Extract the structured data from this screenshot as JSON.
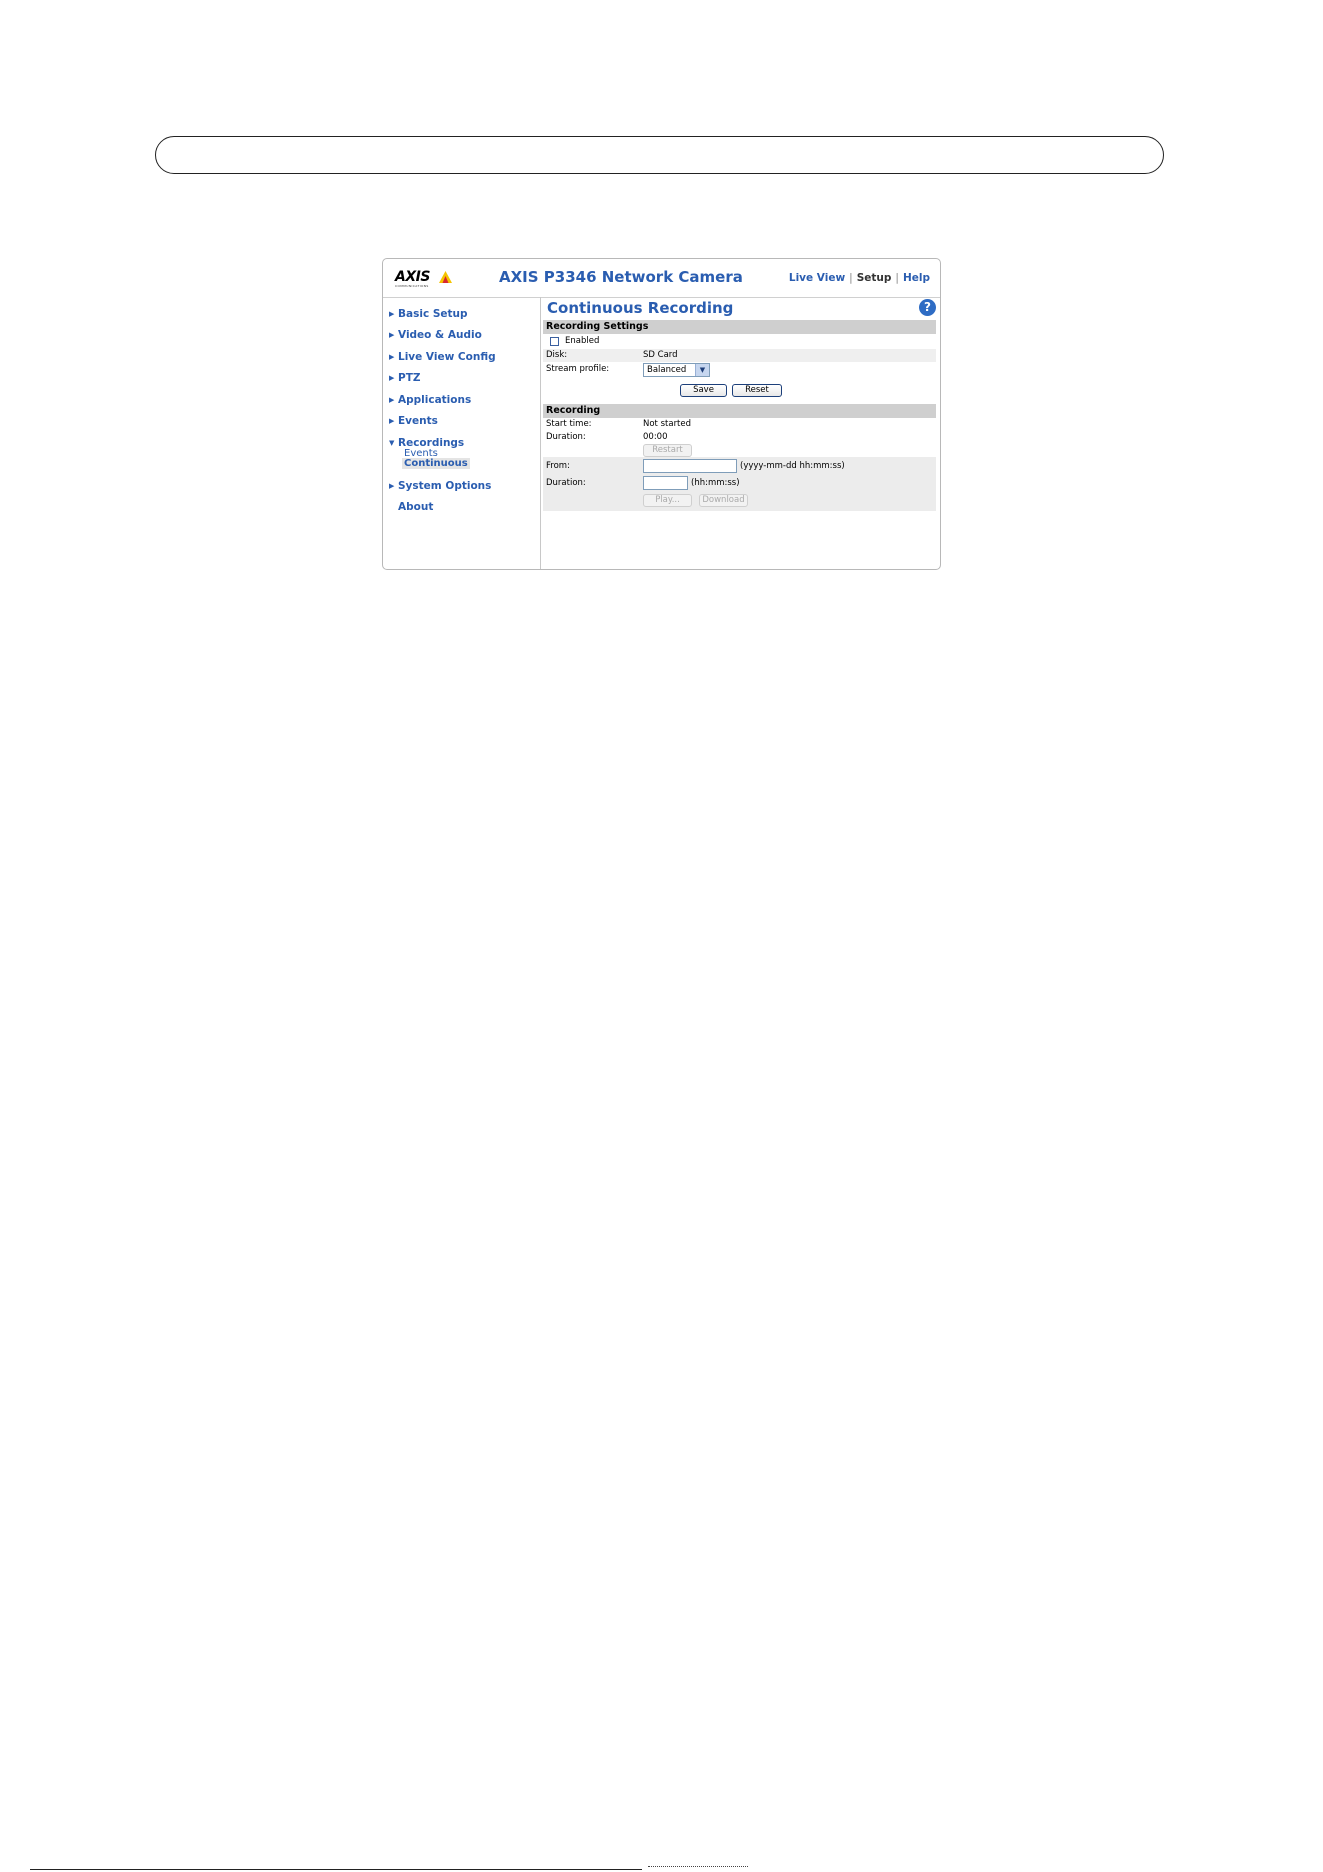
{
  "app": {
    "logo_text": "AXIS",
    "logo_subtext": "COMMUNICATIONS",
    "title": "AXIS P3346 Network Camera",
    "top_links": {
      "live_view": "Live View",
      "setup": "Setup",
      "help": "Help",
      "separator": "|"
    }
  },
  "sidebar": {
    "items": [
      {
        "label": "Basic Setup"
      },
      {
        "label": "Video & Audio"
      },
      {
        "label": "Live View Config"
      },
      {
        "label": "PTZ"
      },
      {
        "label": "Applications"
      },
      {
        "label": "Events"
      },
      {
        "label": "Recordings"
      },
      {
        "label": "System Options"
      },
      {
        "label": "About"
      }
    ],
    "recordings_sub": [
      {
        "label": "Events"
      },
      {
        "label": "Continuous"
      }
    ]
  },
  "main": {
    "page_title": "Continuous Recording",
    "help_icon": "?",
    "recording_settings": {
      "heading": "Recording Settings",
      "enabled_label": "Enabled",
      "enabled_checked": false,
      "disk_label": "Disk:",
      "disk_value": "SD Card",
      "stream_profile_label": "Stream profile:",
      "stream_profile_value": "Balanced",
      "dropdown_arrow": "▼",
      "save_button": "Save",
      "reset_button": "Reset"
    },
    "recording": {
      "heading": "Recording",
      "start_time_label": "Start time:",
      "start_time_value": "Not started",
      "duration_label": "Duration:",
      "duration_value": "00:00",
      "restart_button": "Restart",
      "from_label": "From:",
      "from_value": "",
      "from_hint": "(yyyy-mm-dd hh:mm:ss)",
      "duration_input_label": "Duration:",
      "duration_input_value": "",
      "duration_hint": "(hh:mm:ss)",
      "play_button": "Play...",
      "download_button": "Download"
    }
  },
  "colors": {
    "link_blue": "#2a5db0",
    "section_grey": "#cfcfcf",
    "logo_yellow": "#f5c400",
    "logo_red": "#d8282f"
  }
}
